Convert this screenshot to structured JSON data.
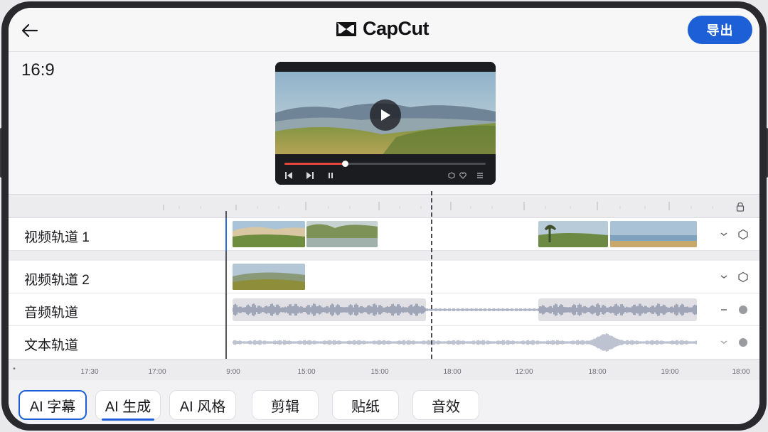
{
  "app": {
    "name": "CapCut",
    "export_label": "导出"
  },
  "preview": {
    "aspect_ratio": "16:9",
    "playback_progress": 0.3
  },
  "tracks": [
    {
      "label": "视频轨道 1"
    },
    {
      "label": "视频轨道 2"
    },
    {
      "label": "音频轨道"
    },
    {
      "label": "文本轨道"
    }
  ],
  "timeline": {
    "time_labels": [
      "17:30",
      "17:00",
      "9:00",
      "15:00",
      "15:00",
      "18:00",
      "12:00",
      "18:00",
      "19:00",
      "18:00"
    ]
  },
  "tools": [
    {
      "label": "AI 字幕",
      "active": true
    },
    {
      "label": "AI 生成",
      "active": false
    },
    {
      "label": "AI 风格",
      "active": false
    },
    {
      "label": "剪辑",
      "active": false
    },
    {
      "label": "贴纸",
      "active": false
    },
    {
      "label": "音效",
      "active": false
    }
  ],
  "colors": {
    "accent": "#1d5fd6",
    "progress": "#e5463b",
    "device_frame": "#2a2a2e"
  },
  "icons": {
    "back": "arrow-left-icon",
    "logo": "capcut-logo-icon",
    "play": "play-icon",
    "lock": "lock-icon",
    "collapse": "chevron-icon",
    "hexagon": "hexagon-icon",
    "circle": "record-dot-icon"
  }
}
